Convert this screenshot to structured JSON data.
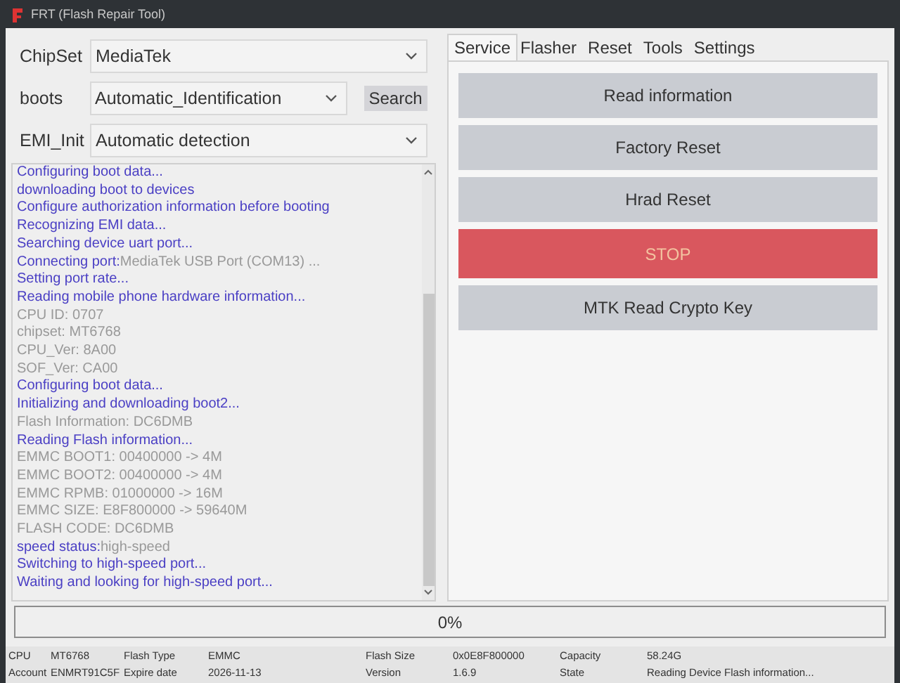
{
  "window": {
    "title": "FRT (Flash Repair Tool)"
  },
  "form": [
    {
      "label": "ChipSet",
      "value": "MediaTek"
    },
    {
      "label": "boots",
      "value": "Automatic_Identification",
      "button": "Search"
    },
    {
      "label": "EMI_Init",
      "value": "Automatic detection"
    }
  ],
  "log": [
    {
      "kind": "status",
      "text": "Configuring boot data..."
    },
    {
      "kind": "status",
      "text": "downloading boot to devices"
    },
    {
      "kind": "status",
      "text": "Configure authorization information before booting"
    },
    {
      "kind": "status",
      "text": "Recognizing EMI data..."
    },
    {
      "kind": "status",
      "text": "Searching device uart port..."
    },
    {
      "kind": "status",
      "text": "Connecting port:",
      "value": "MediaTek USB Port (COM13) ..."
    },
    {
      "kind": "status",
      "text": "Setting port rate..."
    },
    {
      "kind": "status",
      "text": "Reading mobile phone hardware information..."
    },
    {
      "kind": "info",
      "text": "CPU ID: 0707"
    },
    {
      "kind": "info",
      "text": "chipset: MT6768"
    },
    {
      "kind": "info",
      "text": "CPU_Ver: 8A00"
    },
    {
      "kind": "info",
      "text": "SOF_Ver: CA00"
    },
    {
      "kind": "status",
      "text": "Configuring boot data..."
    },
    {
      "kind": "status",
      "text": " Initializing and downloading boot2..."
    },
    {
      "kind": "info",
      "text": "Flash Information: DC6DMB"
    },
    {
      "kind": "status",
      "text": "Reading Flash information..."
    },
    {
      "kind": "info",
      "text": "EMMC BOOT1: 00400000 -> 4M"
    },
    {
      "kind": "info",
      "text": "EMMC BOOT2: 00400000 -> 4M"
    },
    {
      "kind": "info",
      "text": "EMMC RPMB: 01000000 -> 16M"
    },
    {
      "kind": "info",
      "text": "EMMC SIZE: E8F800000 -> 59640M"
    },
    {
      "kind": "info",
      "text": "FLASH CODE: DC6DMB"
    },
    {
      "kind": "status",
      "text": "speed status:",
      "value": "high-speed"
    },
    {
      "kind": "status",
      "text": "Switching to high-speed port..."
    },
    {
      "kind": "status",
      "text": "Waiting and looking for high-speed port..."
    }
  ],
  "tabs": [
    {
      "label": "Service",
      "selected": true
    },
    {
      "label": "Flasher",
      "selected": false
    },
    {
      "label": "Reset",
      "selected": false
    },
    {
      "label": "Tools",
      "selected": false
    },
    {
      "label": "Settings",
      "selected": false
    }
  ],
  "actions": [
    {
      "label": "Read information",
      "kind": "normal"
    },
    {
      "label": "Factory Reset",
      "kind": "normal"
    },
    {
      "label": "Hrad Reset",
      "kind": "normal"
    },
    {
      "label": "STOP",
      "kind": "danger"
    },
    {
      "label": "MTK Read Crypto Key",
      "kind": "normal"
    }
  ],
  "progress": {
    "text": "0%",
    "level": 0
  },
  "status_bar": [
    [
      "CPU",
      "MT6768",
      "Flash Type",
      "EMMC",
      "Flash Size",
      "0x0E8F800000",
      "Capacity",
      "58.24G"
    ],
    [
      "Account",
      "ENMRT91C5F",
      "Expire date",
      "2026-11-13",
      "Version",
      "1.6.9",
      "State",
      "Reading Device Flash information..."
    ]
  ]
}
